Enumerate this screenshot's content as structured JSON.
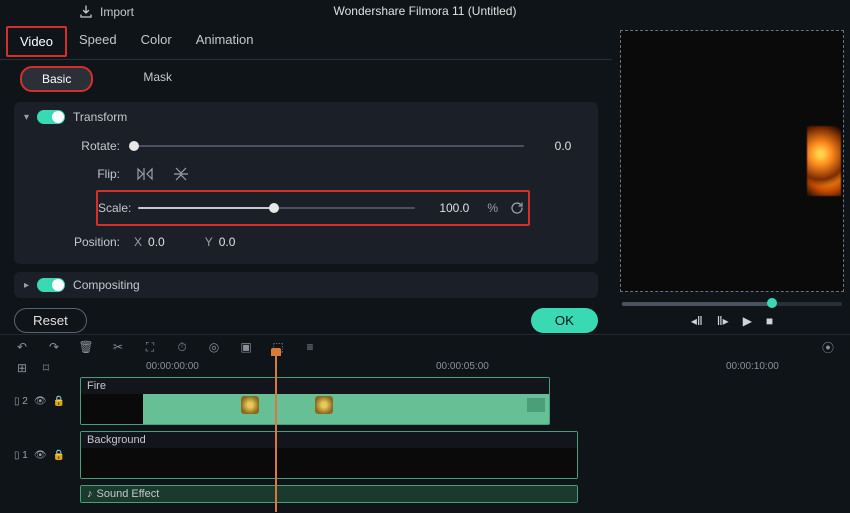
{
  "app": {
    "title": "Wondershare Filmora 11 (Untitled)"
  },
  "toolbar_top": {
    "import": "Import"
  },
  "tabs1": [
    "Video",
    "Speed",
    "Color",
    "Animation"
  ],
  "tabs2": [
    "Basic",
    "Mask"
  ],
  "transform": {
    "title": "Transform",
    "rotate": {
      "label": "Rotate:",
      "value": "0.0"
    },
    "flip": {
      "label": "Flip:"
    },
    "scale": {
      "label": "Scale:",
      "value": "100.0",
      "unit": "%"
    },
    "position": {
      "label": "Position:",
      "x_label": "X",
      "x": "0.0",
      "y_label": "Y",
      "y": "0.0"
    }
  },
  "compositing": {
    "title": "Compositing"
  },
  "buttons": {
    "reset": "Reset",
    "ok": "OK"
  },
  "ruler": {
    "t0": "00:00:00:00",
    "t1": "00:00:05:00",
    "t2": "00:00:10:00"
  },
  "tracks": {
    "fire": {
      "label": "Fire",
      "index": "2"
    },
    "bg": {
      "label": "Background",
      "index": "1"
    },
    "sfx": {
      "label": "Sound Effect"
    }
  }
}
